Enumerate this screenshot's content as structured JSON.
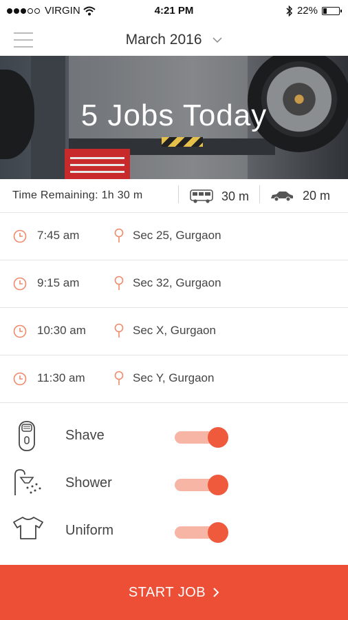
{
  "status_bar": {
    "carrier": "VIRGIN",
    "time": "4:21 PM",
    "battery": "22%"
  },
  "header": {
    "month": "March 2016"
  },
  "hero": {
    "title": "5 Jobs Today"
  },
  "summary": {
    "time_remaining": "Time Remaining: 1h 30 m",
    "bus_time": "30 m",
    "car_time": "20 m"
  },
  "jobs": [
    {
      "time": "7:45 am",
      "location": "Sec 25, Gurgaon"
    },
    {
      "time": "9:15 am",
      "location": "Sec 32, Gurgaon"
    },
    {
      "time": "10:30 am",
      "location": "Sec X, Gurgaon"
    },
    {
      "time": "11:30 am",
      "location": "Sec Y, Gurgaon"
    }
  ],
  "options": [
    {
      "label": "Shave",
      "icon": "shaver-icon",
      "enabled": true
    },
    {
      "label": "Shower",
      "icon": "shower-icon",
      "enabled": true
    },
    {
      "label": "Uniform",
      "icon": "tshirt-icon",
      "enabled": true
    }
  ],
  "footer": {
    "start_label": "START JOB"
  },
  "colors": {
    "accent": "#ec4f36",
    "toggle_on": "#f05a3c",
    "toggle_track": "#f7b6a5",
    "icon_orange": "#f08a6a"
  }
}
